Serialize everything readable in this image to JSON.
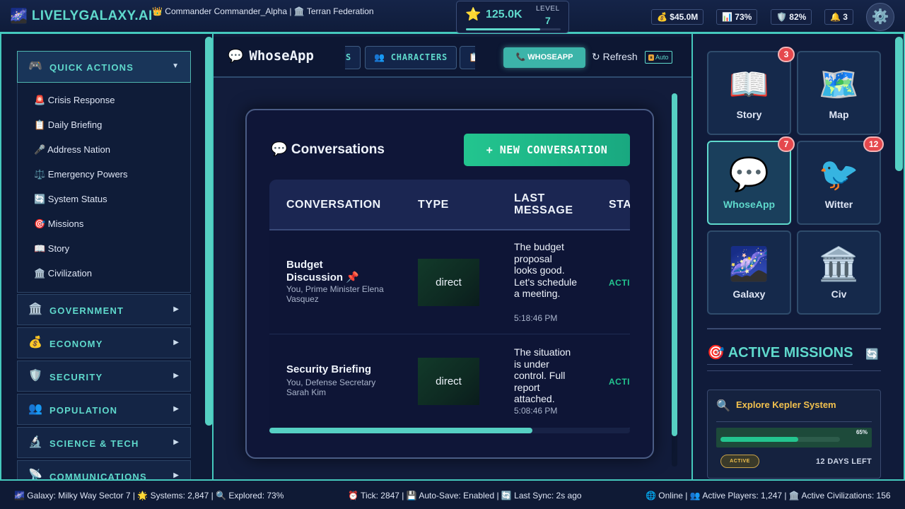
{
  "topbar": {
    "brand_icon": "galaxy-icon",
    "brand_name": "LIVELYGALAXY.AI",
    "commander": "👑 Commander Commander_Alpha | 🏛️ Terran Federation",
    "score": "125.0K",
    "level_label": "LEVEL",
    "level": "7",
    "level_progress": 0.78,
    "stats": [
      {
        "icon": "money-bag-icon",
        "text": "💰 $45.0M"
      },
      {
        "icon": "chart-icon",
        "text": "📊 73%"
      },
      {
        "icon": "shield-icon",
        "text": "🛡️ 82%"
      },
      {
        "icon": "bell-icon",
        "text": "🔔 3"
      }
    ],
    "settings_icon": "gear-icon"
  },
  "sidebar": {
    "quick_actions": {
      "icon": "gamepad-icon",
      "label": "QUICK ACTIONS",
      "arrow": "▼"
    },
    "quick_items": [
      "🚨 Crisis Response",
      "📋 Daily Briefing",
      "🎤 Address Nation",
      "⚖️ Emergency Powers",
      "🔄 System Status",
      "🎯 Missions",
      "📖 Story",
      "🏛️ Civilization"
    ],
    "sections": [
      {
        "icon": "🏛️",
        "label": "GOVERNMENT"
      },
      {
        "icon": "💰",
        "label": "ECONOMY"
      },
      {
        "icon": "🛡️",
        "label": "SECURITY"
      },
      {
        "icon": "👥",
        "label": "POPULATION"
      },
      {
        "icon": "🔬",
        "label": "SCIENCE & TECH"
      },
      {
        "icon": "📡",
        "label": "COMMUNICATIONS"
      }
    ],
    "section_arrow": "▶"
  },
  "main": {
    "app_title": "WhoseApp",
    "tabs": [
      "S",
      "👥 CHARACTERS",
      "📋"
    ],
    "whoseapp_button": "📞 WHOSEAPP",
    "refresh_button": "↻ Refresh",
    "auto_label": "Auto",
    "panel": {
      "title": "💬 Conversations",
      "new_button": "+ NEW CONVERSATION",
      "columns": [
        "CONVERSATION",
        "TYPE",
        "LAST MESSAGE",
        "STA"
      ],
      "rows": [
        {
          "name": "Budget Discussion 📌",
          "participants": "You, Prime Minister Elena Vasquez",
          "type": "direct",
          "message": "The budget proposal looks good. Let's schedule a meeting.",
          "time": "5:18:46 PM",
          "status": "ACTI"
        },
        {
          "name": "Security Briefing",
          "participants": "You, Defense Secretary Sarah Kim",
          "type": "direct",
          "message": "The situation is under control. Full report attached.",
          "time": "5:08:46 PM",
          "status": "ACTI"
        }
      ],
      "table_scroll": 0.73
    }
  },
  "right": {
    "apps": [
      {
        "icon": "📖",
        "label": "Story",
        "badge": "3"
      },
      {
        "icon": "🗺️",
        "label": "Map",
        "badge": ""
      },
      {
        "icon": "💬",
        "label": "WhoseApp",
        "badge": "7",
        "active": true
      },
      {
        "icon": "🐦",
        "label": "Witter",
        "badge": "12"
      },
      {
        "icon": "🌌",
        "label": "Galaxy",
        "badge": ""
      },
      {
        "icon": "🏛️",
        "label": "Civ",
        "badge": ""
      }
    ],
    "missions_title": "🎯 ACTIVE MISSIONS",
    "missions_refresh": "🔄",
    "mission": {
      "icon": "🔍",
      "name": "Explore Kepler System",
      "progress": 0.65,
      "progress_label": "65%",
      "status": "ACTIVE",
      "remaining": "12 DAYS LEFT"
    }
  },
  "footer": {
    "left": "🌌 Galaxy: Milky Way Sector 7 | 🌟 Systems: 2,847 | 🔍 Explored: 73%",
    "center": "⏰ Tick: 2847 | 💾 Auto-Save: Enabled | 🔄 Last Sync: 2s ago",
    "right": "🌐 Online | 👥 Active Players: 1,247 | 🏛️ Active Civilizations: 156"
  }
}
